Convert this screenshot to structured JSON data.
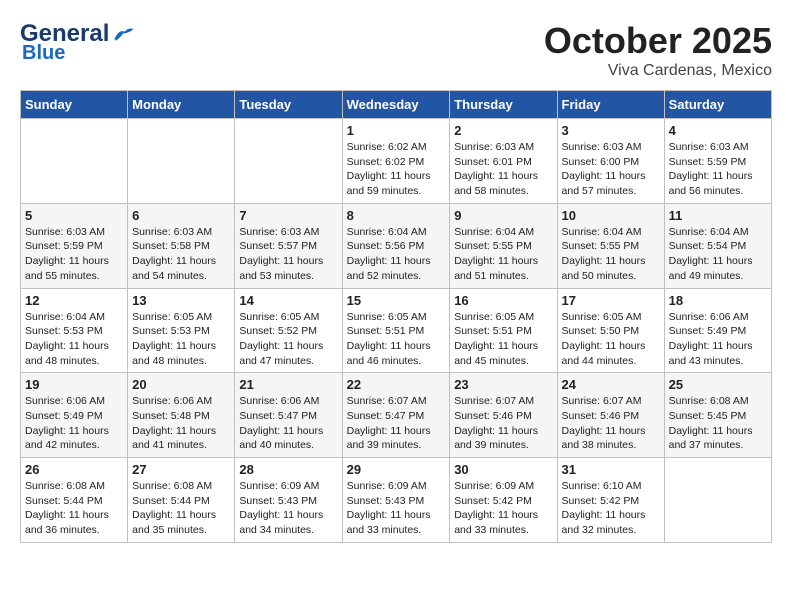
{
  "logo": {
    "general": "General",
    "blue": "Blue",
    "tagline": "GeneralBlue"
  },
  "header": {
    "month": "October 2025",
    "location": "Viva Cardenas, Mexico"
  },
  "days_of_week": [
    "Sunday",
    "Monday",
    "Tuesday",
    "Wednesday",
    "Thursday",
    "Friday",
    "Saturday"
  ],
  "weeks": [
    [
      {
        "day": "",
        "info": ""
      },
      {
        "day": "",
        "info": ""
      },
      {
        "day": "",
        "info": ""
      },
      {
        "day": "1",
        "info": "Sunrise: 6:02 AM\nSunset: 6:02 PM\nDaylight: 11 hours and 59 minutes."
      },
      {
        "day": "2",
        "info": "Sunrise: 6:03 AM\nSunset: 6:01 PM\nDaylight: 11 hours and 58 minutes."
      },
      {
        "day": "3",
        "info": "Sunrise: 6:03 AM\nSunset: 6:00 PM\nDaylight: 11 hours and 57 minutes."
      },
      {
        "day": "4",
        "info": "Sunrise: 6:03 AM\nSunset: 5:59 PM\nDaylight: 11 hours and 56 minutes."
      }
    ],
    [
      {
        "day": "5",
        "info": "Sunrise: 6:03 AM\nSunset: 5:59 PM\nDaylight: 11 hours and 55 minutes."
      },
      {
        "day": "6",
        "info": "Sunrise: 6:03 AM\nSunset: 5:58 PM\nDaylight: 11 hours and 54 minutes."
      },
      {
        "day": "7",
        "info": "Sunrise: 6:03 AM\nSunset: 5:57 PM\nDaylight: 11 hours and 53 minutes."
      },
      {
        "day": "8",
        "info": "Sunrise: 6:04 AM\nSunset: 5:56 PM\nDaylight: 11 hours and 52 minutes."
      },
      {
        "day": "9",
        "info": "Sunrise: 6:04 AM\nSunset: 5:55 PM\nDaylight: 11 hours and 51 minutes."
      },
      {
        "day": "10",
        "info": "Sunrise: 6:04 AM\nSunset: 5:55 PM\nDaylight: 11 hours and 50 minutes."
      },
      {
        "day": "11",
        "info": "Sunrise: 6:04 AM\nSunset: 5:54 PM\nDaylight: 11 hours and 49 minutes."
      }
    ],
    [
      {
        "day": "12",
        "info": "Sunrise: 6:04 AM\nSunset: 5:53 PM\nDaylight: 11 hours and 48 minutes."
      },
      {
        "day": "13",
        "info": "Sunrise: 6:05 AM\nSunset: 5:53 PM\nDaylight: 11 hours and 48 minutes."
      },
      {
        "day": "14",
        "info": "Sunrise: 6:05 AM\nSunset: 5:52 PM\nDaylight: 11 hours and 47 minutes."
      },
      {
        "day": "15",
        "info": "Sunrise: 6:05 AM\nSunset: 5:51 PM\nDaylight: 11 hours and 46 minutes."
      },
      {
        "day": "16",
        "info": "Sunrise: 6:05 AM\nSunset: 5:51 PM\nDaylight: 11 hours and 45 minutes."
      },
      {
        "day": "17",
        "info": "Sunrise: 6:05 AM\nSunset: 5:50 PM\nDaylight: 11 hours and 44 minutes."
      },
      {
        "day": "18",
        "info": "Sunrise: 6:06 AM\nSunset: 5:49 PM\nDaylight: 11 hours and 43 minutes."
      }
    ],
    [
      {
        "day": "19",
        "info": "Sunrise: 6:06 AM\nSunset: 5:49 PM\nDaylight: 11 hours and 42 minutes."
      },
      {
        "day": "20",
        "info": "Sunrise: 6:06 AM\nSunset: 5:48 PM\nDaylight: 11 hours and 41 minutes."
      },
      {
        "day": "21",
        "info": "Sunrise: 6:06 AM\nSunset: 5:47 PM\nDaylight: 11 hours and 40 minutes."
      },
      {
        "day": "22",
        "info": "Sunrise: 6:07 AM\nSunset: 5:47 PM\nDaylight: 11 hours and 39 minutes."
      },
      {
        "day": "23",
        "info": "Sunrise: 6:07 AM\nSunset: 5:46 PM\nDaylight: 11 hours and 39 minutes."
      },
      {
        "day": "24",
        "info": "Sunrise: 6:07 AM\nSunset: 5:46 PM\nDaylight: 11 hours and 38 minutes."
      },
      {
        "day": "25",
        "info": "Sunrise: 6:08 AM\nSunset: 5:45 PM\nDaylight: 11 hours and 37 minutes."
      }
    ],
    [
      {
        "day": "26",
        "info": "Sunrise: 6:08 AM\nSunset: 5:44 PM\nDaylight: 11 hours and 36 minutes."
      },
      {
        "day": "27",
        "info": "Sunrise: 6:08 AM\nSunset: 5:44 PM\nDaylight: 11 hours and 35 minutes."
      },
      {
        "day": "28",
        "info": "Sunrise: 6:09 AM\nSunset: 5:43 PM\nDaylight: 11 hours and 34 minutes."
      },
      {
        "day": "29",
        "info": "Sunrise: 6:09 AM\nSunset: 5:43 PM\nDaylight: 11 hours and 33 minutes."
      },
      {
        "day": "30",
        "info": "Sunrise: 6:09 AM\nSunset: 5:42 PM\nDaylight: 11 hours and 33 minutes."
      },
      {
        "day": "31",
        "info": "Sunrise: 6:10 AM\nSunset: 5:42 PM\nDaylight: 11 hours and 32 minutes."
      },
      {
        "day": "",
        "info": ""
      }
    ]
  ]
}
